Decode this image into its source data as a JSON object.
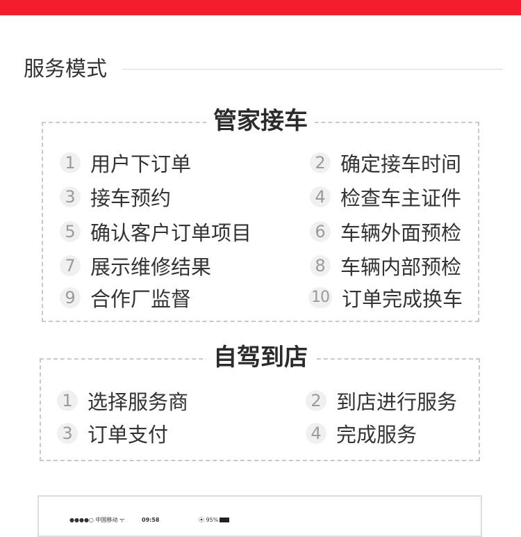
{
  "section": {
    "title": "服务模式"
  },
  "butler": {
    "title": "管家接车",
    "steps": [
      {
        "num": "1",
        "label": "用户下订单"
      },
      {
        "num": "2",
        "label": "确定接车时间"
      },
      {
        "num": "3",
        "label": "接车预约"
      },
      {
        "num": "4",
        "label": "检查车主证件"
      },
      {
        "num": "5",
        "label": "确认客户订单项目"
      },
      {
        "num": "6",
        "label": "车辆外面预检"
      },
      {
        "num": "7",
        "label": "展示维修结果"
      },
      {
        "num": "8",
        "label": "车辆内部预检"
      },
      {
        "num": "9",
        "label": "合作厂监督"
      },
      {
        "num": "10",
        "label": "订单完成换车"
      }
    ]
  },
  "self_drive": {
    "title": "自驾到店",
    "steps": [
      {
        "num": "1",
        "label": "选择服务商"
      },
      {
        "num": "2",
        "label": "到店进行服务"
      },
      {
        "num": "3",
        "label": "订单支付"
      },
      {
        "num": "4",
        "label": "完成服务"
      }
    ]
  },
  "phone": {
    "carrier": "●●●●○ 中国移动 ᯤ",
    "time": "09:58",
    "battery": "⦿ 95%"
  },
  "colors": {
    "accent": "#f41c2d",
    "dash": "#c9c9c9"
  }
}
